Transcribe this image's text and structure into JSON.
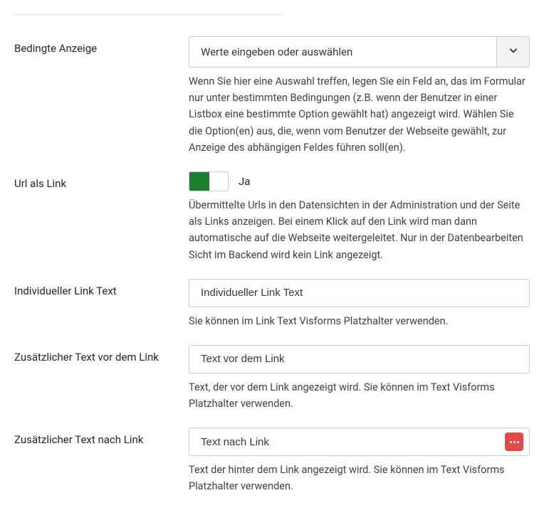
{
  "fields": {
    "conditional_display": {
      "label": "Bedingte Anzeige",
      "select_placeholder": "Werte eingeben oder auswählen",
      "helper": "Wenn Sie hier eine Auswahl treffen, legen Sie ein Feld an, das im Formular nur unter bestimmten Bedingungen (z.B. wenn der Benutzer in einer Listbox eine bestimmte Option gewählt hat) angezeigt wird. Wählen Sie die Option(en) aus, die, wenn vom Benutzer der Webseite gewählt, zur Anzeige des abhängigen Feldes führen soll(en)."
    },
    "url_as_link": {
      "label": "Url als Link",
      "state_label": "Ja",
      "helper": "Übermittelte Urls in den Datensichten in der Administration und der Seite als Links anzeigen. Bei einem Klick auf den Link wird man dann automatische auf die Webseite weitergeleitet. Nur in der Datenbearbeiten Sicht im Backend wird kein Link angezeigt."
    },
    "link_text": {
      "label": "Individueller Link Text",
      "placeholder": "Individueller Link Text",
      "helper": "Sie können im Link Text Visforms Platzhalter verwenden."
    },
    "text_before": {
      "label": "Zusätzlicher Text vor dem Link",
      "placeholder": "Text vor dem Link",
      "helper": "Text, der vor dem Link angezeigt wird. Sie können im Text Visforms Platzhalter verwenden."
    },
    "text_after": {
      "label": "Zusätzlicher Text nach Link",
      "placeholder": "Text nach Link",
      "helper": "Text der hinter dem Link angezeigt wird. Sie können im Text Visforms Platzhalter verwenden."
    }
  }
}
